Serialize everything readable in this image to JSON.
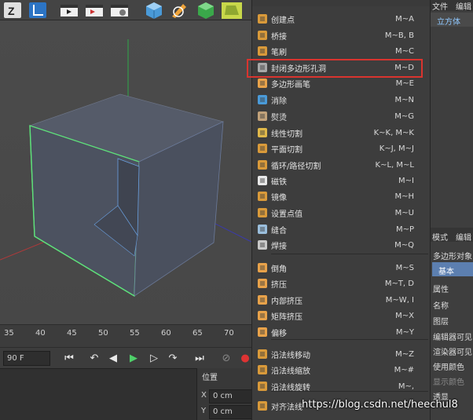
{
  "toolbar": {
    "icons": [
      "z-snap-icon",
      "axis-icon",
      "render-view-icon",
      "render-picture-icon",
      "render-settings-icon",
      "cube-icon",
      "pen-icon",
      "subdivision-icon",
      "deformer-icon"
    ]
  },
  "timeline": {
    "ruler_labels": [
      "35",
      "40",
      "45",
      "50",
      "55",
      "60",
      "65",
      "70"
    ],
    "frame_field": "90 F"
  },
  "coords": {
    "header": "位置",
    "x_label": "X",
    "x_value": "0 cm",
    "y_label": "Y",
    "y_value": "0 cm"
  },
  "menu": {
    "top_partial": "",
    "items": [
      {
        "label": "创建点",
        "shortcut": "M~A",
        "icon": "create-point-icon"
      },
      {
        "label": "桥接",
        "shortcut": "M~B, B",
        "icon": "bridge-icon"
      },
      {
        "label": "笔刷",
        "shortcut": "M~C",
        "icon": "brush-icon"
      },
      {
        "label": "封闭多边形孔洞",
        "shortcut": "M~D",
        "icon": "close-polygon-hole-icon"
      },
      {
        "label": "多边形画笔",
        "shortcut": "M~E",
        "icon": "polygon-pen-icon"
      },
      {
        "label": "消除",
        "shortcut": "M~N",
        "icon": "dissolve-icon"
      },
      {
        "label": "熨烫",
        "shortcut": "M~G",
        "icon": "iron-icon"
      },
      {
        "label": "线性切割",
        "shortcut": "K~K, M~K",
        "icon": "line-cut-icon"
      },
      {
        "label": "平面切割",
        "shortcut": "K~J, M~J",
        "icon": "plane-cut-icon"
      },
      {
        "label": "循环/路径切割",
        "shortcut": "K~L, M~L",
        "icon": "loop-cut-icon"
      },
      {
        "label": "磁铁",
        "shortcut": "M~I",
        "icon": "magnet-icon"
      },
      {
        "label": "镜像",
        "shortcut": "M~H",
        "icon": "mirror-icon"
      },
      {
        "label": "设置点值",
        "shortcut": "M~U",
        "icon": "set-point-value-icon"
      },
      {
        "label": "缝合",
        "shortcut": "M~P",
        "icon": "stitch-icon"
      },
      {
        "label": "焊接",
        "shortcut": "M~Q",
        "icon": "weld-icon"
      },
      {
        "label": "倒角",
        "shortcut": "M~S",
        "icon": "bevel-icon"
      },
      {
        "label": "挤压",
        "shortcut": "M~T, D",
        "icon": "extrude-icon"
      },
      {
        "label": "内部挤压",
        "shortcut": "M~W, I",
        "icon": "extrude-inner-icon"
      },
      {
        "label": "矩阵挤压",
        "shortcut": "M~X",
        "icon": "matrix-extrude-icon"
      },
      {
        "label": "偏移",
        "shortcut": "M~Y",
        "icon": "offset-icon"
      },
      {
        "label": "沿法线移动",
        "shortcut": "M~Z",
        "icon": "normal-move-icon"
      },
      {
        "label": "沿法线缩放",
        "shortcut": "M~#",
        "icon": "normal-scale-icon"
      },
      {
        "label": "沿法线旋转",
        "shortcut": "M~,",
        "icon": "normal-rotate-icon"
      },
      {
        "label": "对齐法线",
        "shortcut": "",
        "icon": "align-normals-icon"
      }
    ]
  },
  "right_panel": {
    "file": "文件",
    "edit": "编辑",
    "cube": "立方体",
    "mode": "模式",
    "edit2": "编辑",
    "object": "多边形对象",
    "basic": "基本",
    "attrs": "属性",
    "rows": [
      "名称",
      "图层",
      "编辑器可见",
      "渲染器可见",
      "使用颜色",
      "显示颜色",
      "透显"
    ]
  },
  "watermark": "https://blog.csdn.net/heechul8",
  "colors": {
    "highlight_border": "#d9342f",
    "cube_face": "#4c5260",
    "selected_edge": "#5ee07a",
    "axis_y": "#2fa84a",
    "axis_x": "#b0393a",
    "axis_z": "#3a3ab0"
  }
}
